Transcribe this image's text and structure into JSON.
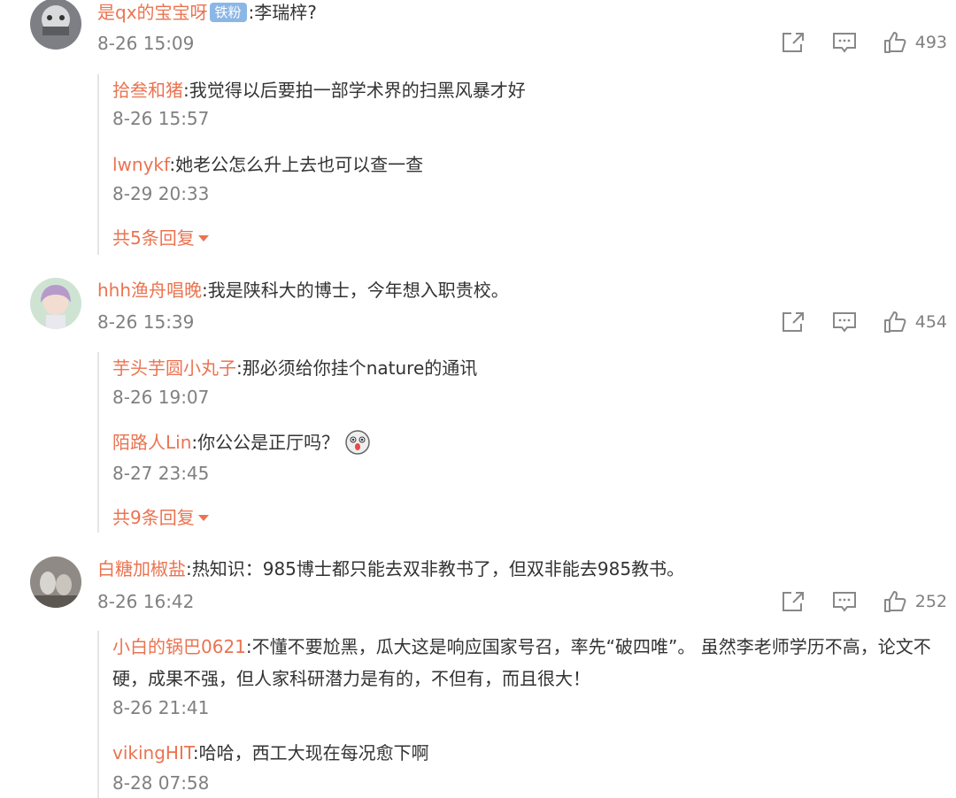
{
  "comments": [
    {
      "user": "是qx的宝宝呀",
      "badge": "铁粉",
      "text": ":李瑞梓?",
      "time": "8-26 15:09",
      "likes": "493",
      "replies": [
        {
          "user": "拾叁和猪",
          "text": ":我觉得以后要拍一部学术界的扫黑风暴才好",
          "time": "8-26 15:57"
        },
        {
          "user": "lwnykf",
          "text": ":她老公怎么升上去也可以查一查",
          "time": "8-29 20:33"
        }
      ],
      "more": "共5条回复"
    },
    {
      "user": "hhh渔舟唱晚",
      "text": ":我是陕科大的博士，今年想入职贵校。",
      "time": "8-26 15:39",
      "likes": "454",
      "replies": [
        {
          "user": "芋头芋圆小丸子",
          "text": ":那必须给你挂个nature的通讯",
          "time": "8-26 19:07"
        },
        {
          "user": "陌路人Lin",
          "text": ":你公公是正厅吗？",
          "time": "8-27 23:45"
        }
      ],
      "more": "共9条回复"
    },
    {
      "user": "白糖加椒盐",
      "text": ":热知识：985博士都只能去双非教书了，但双非能去985教书。",
      "time": "8-26 16:42",
      "likes": "252",
      "replies": [
        {
          "user": "小白的锅巴0621",
          "text": ":不懂不要尬黑，瓜大这是响应国家号召，率先“破四唯”。 虽然李老师学历不高，论文不硬，成果不强，但人家科研潜力是有的，不但有，而且很大！",
          "time": "8-26 21:41"
        },
        {
          "user": "vikingHIT",
          "text": ":哈哈，西工大现在每况愈下啊",
          "time": "8-28 07:58"
        }
      ]
    }
  ]
}
